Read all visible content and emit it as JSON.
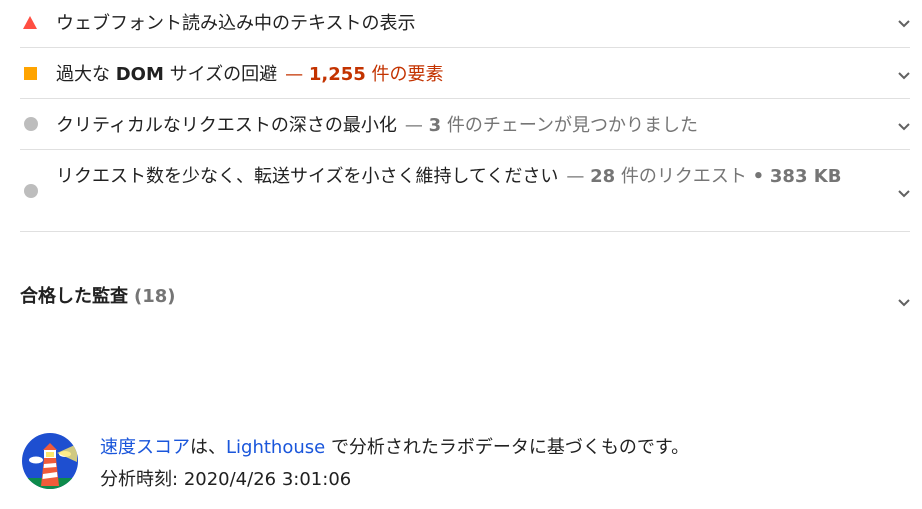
{
  "audits": [
    {
      "status": "fail",
      "title": "ウェブフォント読み込み中のテキストの表示",
      "display_value": ""
    },
    {
      "status": "average",
      "title_prefix": "過大な",
      "title_dom": "DOM",
      "title_suffix": "サイズの回避",
      "separator": "—",
      "display_number": "1,255",
      "display_value": "件の要素"
    },
    {
      "status": "informative",
      "title": "クリティカルなリクエストの深さの最小化",
      "separator": "—",
      "display_number": "3",
      "display_value": "件のチェーンが見つかりました"
    },
    {
      "status": "informative",
      "title": "リクエスト数を少なく、転送サイズを小さく維持してください",
      "separator": "—",
      "display_number": "28",
      "display_value": "件のリクエスト",
      "display_dot": "•",
      "display_size": "383 KB"
    }
  ],
  "passed_group": {
    "title": "合格した監査",
    "count": "(18)"
  },
  "footer": {
    "link_speed_score": "速度スコア",
    "text_ha": "は、",
    "link_lighthouse": "Lighthouse",
    "text_rest": "で分析されたラボデータに基づくものです。",
    "timestamp_label": "分析時刻:",
    "timestamp_value": "2020/4/26 3:01:06"
  },
  "colors": {
    "fail": "#ff4e42",
    "average": "#ffa400",
    "informative": "#bdbdbd",
    "warn_text": "#c33300",
    "link": "#1a56db"
  }
}
